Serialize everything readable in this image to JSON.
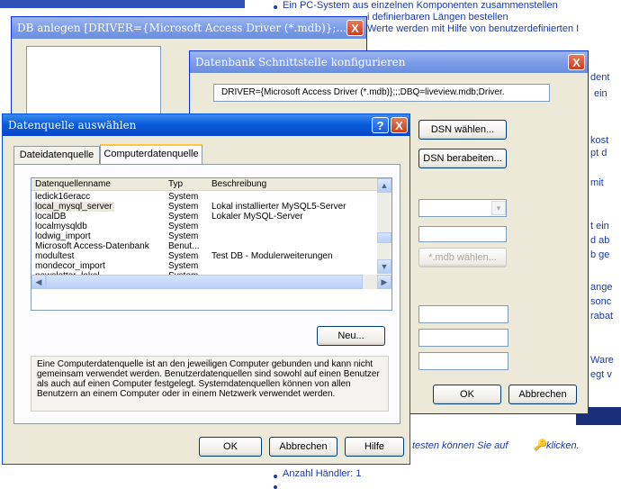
{
  "background_page": {
    "lines": [
      "Ein PC-System aus einzelnen Komponenten zusammenstellen",
      "i definierbaren Längen bestellen",
      "Werte werden mit Hilfe von benutzerdefinierten I",
      "dent",
      "ein",
      "kost",
      "pt d",
      "mit",
      "t ein",
      "d ab",
      "b ge",
      "ange",
      "sonc",
      "rabat",
      "Ware",
      "egt v",
      "testen können Sie auf",
      "klicken.",
      "Anzahl Händler: 1"
    ]
  },
  "win_db": {
    "title": "DB anlegen [DRIVER={Microsoft Access Driver (*.mdb)};...",
    "close_label": "X"
  },
  "win_iface": {
    "title": "Datenbank Schnittstelle konfigurieren",
    "close_label": "X",
    "connection_string": "DRIVER={Microsoft Access Driver (*.mdb)};;;DBQ=liveview.mdb;Driver.",
    "dsn_select_label": "DSN wählen...",
    "dsn_edit_label": "DSN berabeiten...",
    "mdb_select_label": "*.mdb wählen...",
    "ok_label": "OK",
    "cancel_label": "Abbrechen"
  },
  "win_dsn": {
    "title": "Datenquelle auswählen",
    "help_label": "?",
    "close_label": "X",
    "tabs": [
      "Dateidatenquelle",
      "Computerdatenquelle"
    ],
    "columns": [
      "Datenquellenname",
      "Typ",
      "Beschreibung"
    ],
    "rows": [
      {
        "name": "ledick16eracc",
        "type": "System",
        "desc": ""
      },
      {
        "name": "local_mysql_server",
        "type": "System",
        "desc": "Lokal installierter MySQL5-Server"
      },
      {
        "name": "localDB",
        "type": "System",
        "desc": "Lokaler MySQL-Server"
      },
      {
        "name": "localmysqldb",
        "type": "System",
        "desc": ""
      },
      {
        "name": "lodwig_import",
        "type": "System",
        "desc": ""
      },
      {
        "name": "Microsoft Access-Datenbank",
        "type": "Benut...",
        "desc": ""
      },
      {
        "name": "modultest",
        "type": "System",
        "desc": "Test DB - Modulerweiterungen"
      },
      {
        "name": "mondecor_import",
        "type": "System",
        "desc": ""
      },
      {
        "name": "newsletter_lokal",
        "type": "System",
        "desc": "....."
      }
    ],
    "new_label": "Neu...",
    "info_text": "Eine Computerdatenquelle ist an den jeweiligen Computer gebunden und kann nicht gemeinsam verwendet werden. Benutzerdatenquellen sind sowohl auf einen Benutzer als auch auf einen Computer festgelegt. Systemdatenquellen können von allen Benutzern an einem Computer oder in einem Netzwerk verwendet werden.",
    "ok_label": "OK",
    "cancel_label": "Abbrechen",
    "help_button_label": "Hilfe"
  },
  "colors": {
    "title_active": "#0a5ddb",
    "title_inactive": "#7c9de8",
    "close_red": "#c7401c",
    "dialog_bg": "#ece9d8",
    "link_blue": "#1a3aa5"
  }
}
